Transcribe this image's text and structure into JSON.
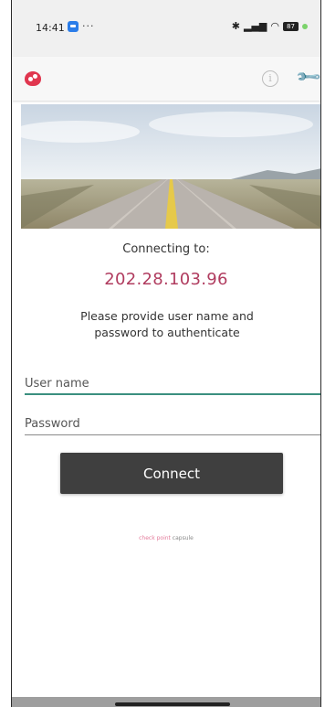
{
  "status_bar": {
    "time": "14:41",
    "dots": "···",
    "battery": "87"
  },
  "app": {
    "logo_icon": "capsule-logo-icon",
    "info_icon_glyph": "i",
    "wrench_icon": "wrench-icon"
  },
  "main": {
    "connecting_label": "Connecting to:",
    "host": "202.28.103.96",
    "prompt": "Please provide user name and password to authenticate",
    "username": {
      "placeholder": "User name",
      "value": ""
    },
    "password": {
      "placeholder": "Password",
      "value": ""
    },
    "connect_label": "Connect"
  },
  "footer": {
    "brand_part1": "check point",
    "brand_part2": " capsule"
  },
  "colors": {
    "accent": "#b03c5f",
    "button": "#3f3f3f",
    "focus_underline": "#3b8f7f",
    "logo": "#e0364f"
  }
}
